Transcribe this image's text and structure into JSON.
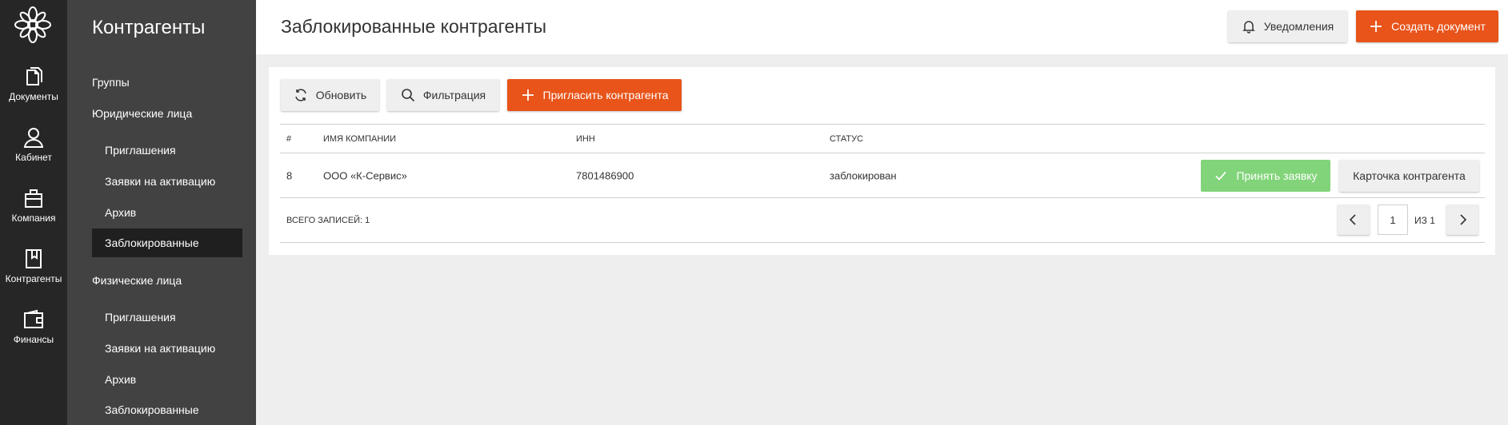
{
  "rail": {
    "items": [
      {
        "label": "Документы",
        "icon": "documents-icon"
      },
      {
        "label": "Кабинет",
        "icon": "user-icon"
      },
      {
        "label": "Компания",
        "icon": "briefcase-icon"
      },
      {
        "label": "Контрагенты",
        "icon": "bookmark-book-icon"
      },
      {
        "label": "Финансы",
        "icon": "wallet-icon"
      }
    ]
  },
  "subnav": {
    "title": "Контрагенты",
    "groups": "Группы",
    "legal": "Юридические лица",
    "legal_items": [
      "Приглашения",
      "Заявки на активацию",
      "Архив",
      "Заблокированные"
    ],
    "physical": "Физические лица",
    "physical_items": [
      "Приглашения",
      "Заявки на активацию",
      "Архив",
      "Заблокированные"
    ]
  },
  "header": {
    "title": "Заблокированные контрагенты",
    "notifications_label": "Уведомления",
    "create_label": "Создать документ"
  },
  "toolbar": {
    "refresh_label": "Обновить",
    "filter_label": "Фильтрация",
    "invite_label": "Пригласить контрагента"
  },
  "table": {
    "columns": [
      "#",
      "ИМЯ КОМПАНИИ",
      "ИНН",
      "СТАТУС"
    ],
    "rows": [
      {
        "num": "8",
        "company": "ООО «К-Сервис»",
        "inn": "7801486900",
        "status": "заблокирован",
        "accept_label": "Принять заявку",
        "card_label": "Карточка контрагента"
      }
    ],
    "total_label": "ВСЕГО ЗАПИСЕЙ: 1",
    "pagination": {
      "current_page": "1",
      "of_label": "ИЗ 1"
    }
  },
  "colors": {
    "accent": "#e8541a",
    "success": "#82d47a",
    "rail": "#262626",
    "subnav": "#424242",
    "active": "#1f1f1f"
  }
}
